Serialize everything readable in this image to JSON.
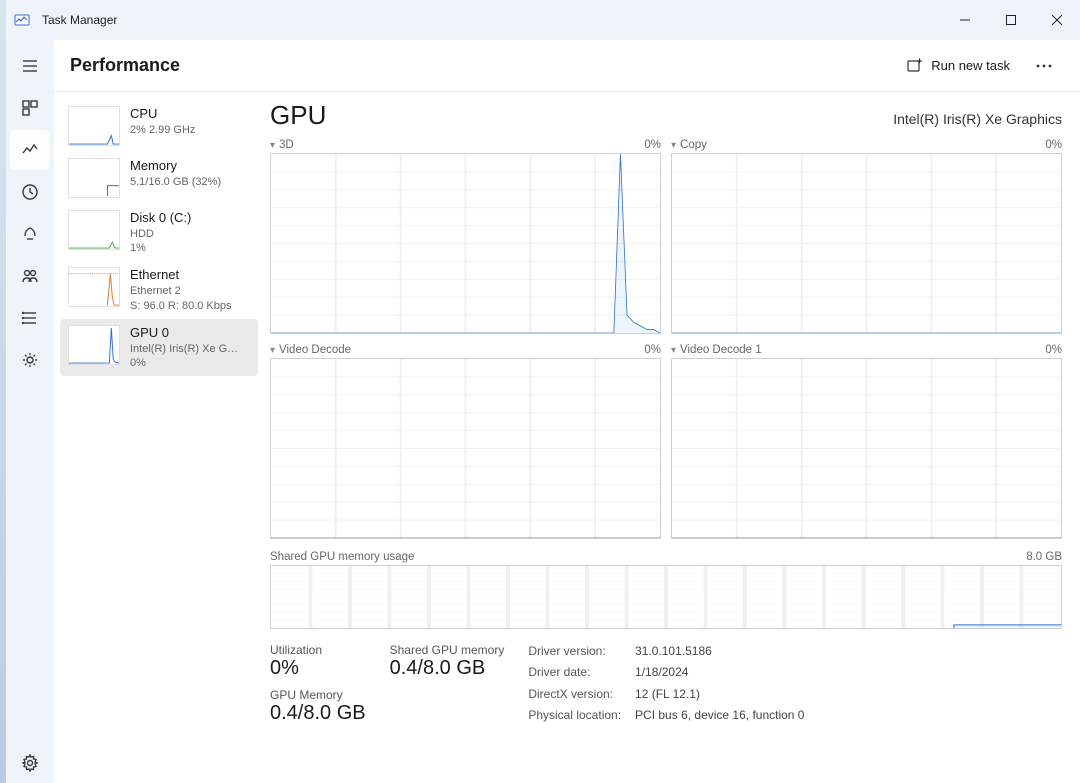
{
  "window": {
    "title": "Task Manager"
  },
  "header": {
    "title": "Performance",
    "run_new_task": "Run new task"
  },
  "sidebar": {
    "items": [
      {
        "name": "CPU",
        "sub1": "2%  2.99 GHz",
        "sub2": ""
      },
      {
        "name": "Memory",
        "sub1": "5.1/16.0 GB (32%)",
        "sub2": ""
      },
      {
        "name": "Disk 0 (C:)",
        "sub1": "HDD",
        "sub2": "1%"
      },
      {
        "name": "Ethernet",
        "sub1": "Ethernet 2",
        "sub2": "S: 96.0 R: 80.0 Kbps"
      },
      {
        "name": "GPU 0",
        "sub1": "Intel(R) Iris(R) Xe G…",
        "sub2": "0%"
      }
    ],
    "selected_index": 4
  },
  "detail": {
    "title": "GPU",
    "device_name": "Intel(R) Iris(R) Xe Graphics",
    "graphs": [
      {
        "label": "3D",
        "value": "0%"
      },
      {
        "label": "Copy",
        "value": "0%"
      },
      {
        "label": "Video Decode",
        "value": "0%"
      },
      {
        "label": "Video Decode 1",
        "value": "0%"
      }
    ],
    "memory_graph": {
      "label": "Shared GPU memory usage",
      "max": "8.0 GB"
    },
    "stats": {
      "utilization_label": "Utilization",
      "utilization_value": "0%",
      "shared_mem_label": "Shared GPU memory",
      "shared_mem_value": "0.4/8.0 GB",
      "gpu_mem_label": "GPU Memory",
      "gpu_mem_value": "0.4/8.0 GB",
      "driver_version_label": "Driver version:",
      "driver_version_value": "31.0.101.5186",
      "driver_date_label": "Driver date:",
      "driver_date_value": "1/18/2024",
      "directx_label": "DirectX version:",
      "directx_value": "12 (FL 12.1)",
      "location_label": "Physical location:",
      "location_value": "PCI bus 6, device 16, function 0"
    }
  },
  "chart_data": [
    {
      "type": "line",
      "title": "3D",
      "ylim": [
        0,
        100
      ],
      "ylabel": "%",
      "values": [
        0,
        0,
        0,
        0,
        0,
        0,
        0,
        0,
        0,
        0,
        0,
        0,
        0,
        0,
        0,
        0,
        0,
        0,
        0,
        0,
        0,
        0,
        0,
        0,
        0,
        0,
        0,
        0,
        0,
        0,
        0,
        0,
        0,
        0,
        0,
        0,
        0,
        0,
        0,
        0,
        0,
        0,
        0,
        0,
        0,
        0,
        0,
        0,
        0,
        0,
        0,
        0,
        0,
        100,
        10,
        6,
        4,
        2,
        2,
        0
      ]
    },
    {
      "type": "line",
      "title": "Copy",
      "ylim": [
        0,
        100
      ],
      "ylabel": "%",
      "values": [
        0,
        0,
        0,
        0,
        0,
        0,
        0,
        0,
        0,
        0,
        0,
        0,
        0,
        0,
        0,
        0,
        0,
        0,
        0,
        0,
        0,
        0,
        0,
        0,
        0,
        0,
        0,
        0,
        0,
        0,
        0,
        0,
        0,
        0,
        0,
        0,
        0,
        0,
        0,
        0,
        0,
        0,
        0,
        0,
        0,
        0,
        0,
        0,
        0,
        0,
        0,
        0,
        0,
        0,
        0,
        0,
        0,
        0,
        0,
        0
      ]
    },
    {
      "type": "line",
      "title": "Video Decode",
      "ylim": [
        0,
        100
      ],
      "ylabel": "%",
      "values": [
        0,
        0,
        0,
        0,
        0,
        0,
        0,
        0,
        0,
        0,
        0,
        0,
        0,
        0,
        0,
        0,
        0,
        0,
        0,
        0,
        0,
        0,
        0,
        0,
        0,
        0,
        0,
        0,
        0,
        0,
        0,
        0,
        0,
        0,
        0,
        0,
        0,
        0,
        0,
        0,
        0,
        0,
        0,
        0,
        0,
        0,
        0,
        0,
        0,
        0,
        0,
        0,
        0,
        0,
        0,
        0,
        0,
        0,
        0,
        0
      ]
    },
    {
      "type": "line",
      "title": "Video Decode 1",
      "ylim": [
        0,
        100
      ],
      "ylabel": "%",
      "values": [
        0,
        0,
        0,
        0,
        0,
        0,
        0,
        0,
        0,
        0,
        0,
        0,
        0,
        0,
        0,
        0,
        0,
        0,
        0,
        0,
        0,
        0,
        0,
        0,
        0,
        0,
        0,
        0,
        0,
        0,
        0,
        0,
        0,
        0,
        0,
        0,
        0,
        0,
        0,
        0,
        0,
        0,
        0,
        0,
        0,
        0,
        0,
        0,
        0,
        0,
        0,
        0,
        0,
        0,
        0,
        0,
        0,
        0,
        0,
        0
      ]
    },
    {
      "type": "line",
      "title": "Shared GPU memory usage",
      "ylim": [
        0,
        8
      ],
      "ylabel": "GB",
      "values": [
        0.4,
        0.4,
        0.4,
        0.4,
        0.4,
        0.4,
        0.4,
        0.4,
        0.4,
        0.4,
        0.4,
        0.4,
        0.4,
        0.4,
        0.4,
        0.4,
        0.4,
        0.4,
        0.4,
        0.4,
        0.4,
        0.4,
        0.4,
        0.4,
        0.4,
        0.4,
        0.4,
        0.4,
        0.4,
        0.4,
        0.4,
        0.4,
        0.4,
        0.4,
        0.4,
        0.4,
        0.4,
        0.4,
        0.4,
        0.4,
        0.4,
        0.4,
        0.4,
        0.4,
        0.4,
        0.4,
        0.4,
        0.4,
        0.4,
        0.4,
        0.4,
        0.4,
        0.4,
        0.4,
        0.4,
        0.4,
        0.4,
        0.4,
        0.4,
        0.4
      ]
    }
  ],
  "thumb_colors": {
    "cpu": "#2a6fd6",
    "memory": "#9b3fa0",
    "disk": "#4aa246",
    "ethernet_send": "#d47a2a",
    "ethernet_recv": "#e3b85f",
    "gpu": "#2a6fd6"
  }
}
